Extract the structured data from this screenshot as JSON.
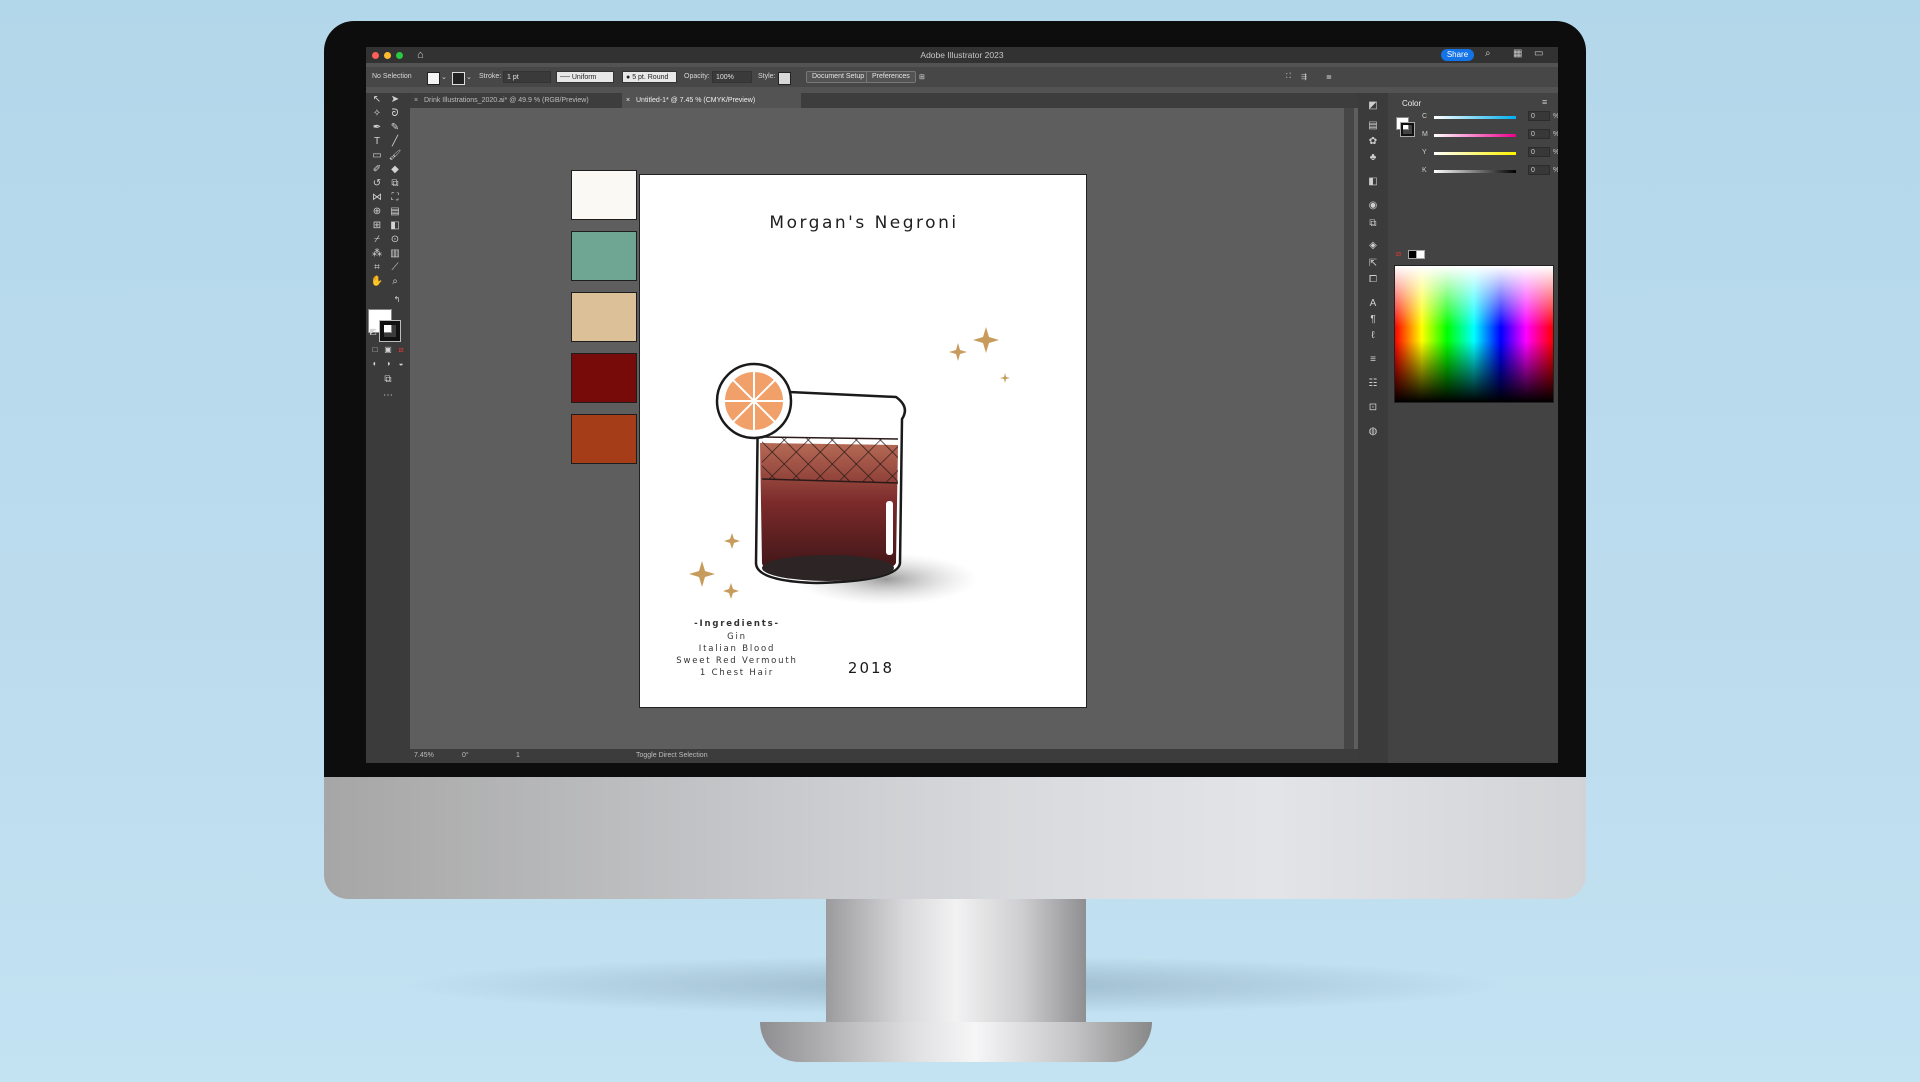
{
  "app": {
    "window_title": "Adobe Illustrator 2023",
    "share_label": "Share"
  },
  "control_bar": {
    "selection": "No Selection",
    "stroke_label": "Stroke:",
    "stroke_weight": "1 pt",
    "profile": "Uniform",
    "brush": "5 pt. Round",
    "opacity_label": "Opacity:",
    "opacity_value": "100%",
    "style_label": "Style:",
    "document_setup": "Document Setup",
    "preferences": "Preferences"
  },
  "tabs": [
    {
      "label": "Drink Illustrations_2020.ai* @ 49.9 % (RGB/Preview)",
      "active": false
    },
    {
      "label": "Untitled-1* @ 7.45 % (CMYK/Preview)",
      "active": true
    }
  ],
  "palette": {
    "colors": [
      "#fbf9f4",
      "#6fa593",
      "#dcc098",
      "#760b09",
      "#a63d19"
    ]
  },
  "artboard": {
    "title": "Morgan's Negroni",
    "ingredients_heading": "-Ingredients-",
    "ingredients": [
      "Gin",
      "Italian Blood",
      "Sweet Red Vermouth",
      "1 Chest Hair"
    ],
    "year": "2018",
    "accent_color": "#c79b5c"
  },
  "status_bar": {
    "zoom": "7.45%",
    "rotation": "0°",
    "artboard_number": "1",
    "hint": "Toggle Direct Selection"
  },
  "color_panel": {
    "title": "Color",
    "channels": [
      {
        "label": "C",
        "value": "0",
        "gradient": [
          "#ffffff",
          "#00aeef"
        ]
      },
      {
        "label": "M",
        "value": "0",
        "gradient": [
          "#ffffff",
          "#ec008c"
        ]
      },
      {
        "label": "Y",
        "value": "0",
        "gradient": [
          "#ffffff",
          "#fff200"
        ]
      },
      {
        "label": "K",
        "value": "0",
        "gradient": [
          "#ffffff",
          "#000000"
        ]
      }
    ],
    "percent_symbol": "%"
  }
}
